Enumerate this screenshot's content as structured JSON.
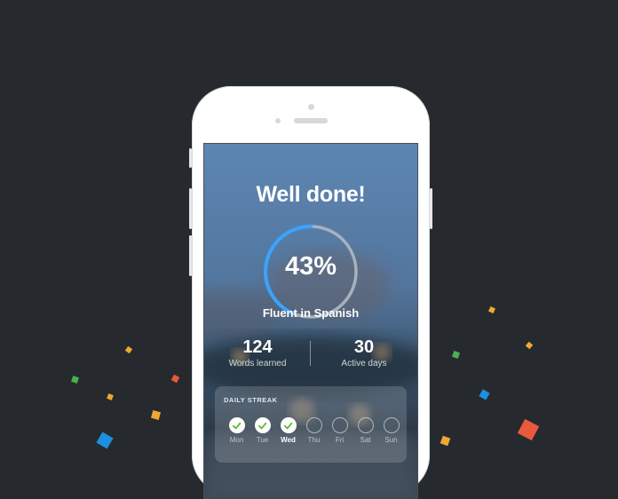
{
  "screen": {
    "title": "Well done!",
    "progress": {
      "percent_label": "43%",
      "value": 0.43,
      "track_color": "#a7b2bd",
      "fill_color": "#3aa3ff"
    },
    "subtitle": "Fluent in Spanish",
    "stats": [
      {
        "value": "124",
        "label": "Words learned"
      },
      {
        "value": "30",
        "label": "Active days"
      }
    ],
    "streak": {
      "title": "DAILY STREAK",
      "check_color": "#5fbf2f",
      "days": [
        {
          "label": "Mon",
          "done": true
        },
        {
          "label": "Tue",
          "done": true
        },
        {
          "label": "Wed",
          "done": true,
          "current": true
        },
        {
          "label": "Thu",
          "done": false
        },
        {
          "label": "Fri",
          "done": false
        },
        {
          "label": "Sat",
          "done": false
        },
        {
          "label": "Sun",
          "done": false
        }
      ]
    }
  },
  "colors": {
    "background": "#262a2e",
    "confetti": [
      "#f0a733",
      "#e85a3c",
      "#48b34e",
      "#1c8fe0",
      "#f4d23b"
    ]
  }
}
